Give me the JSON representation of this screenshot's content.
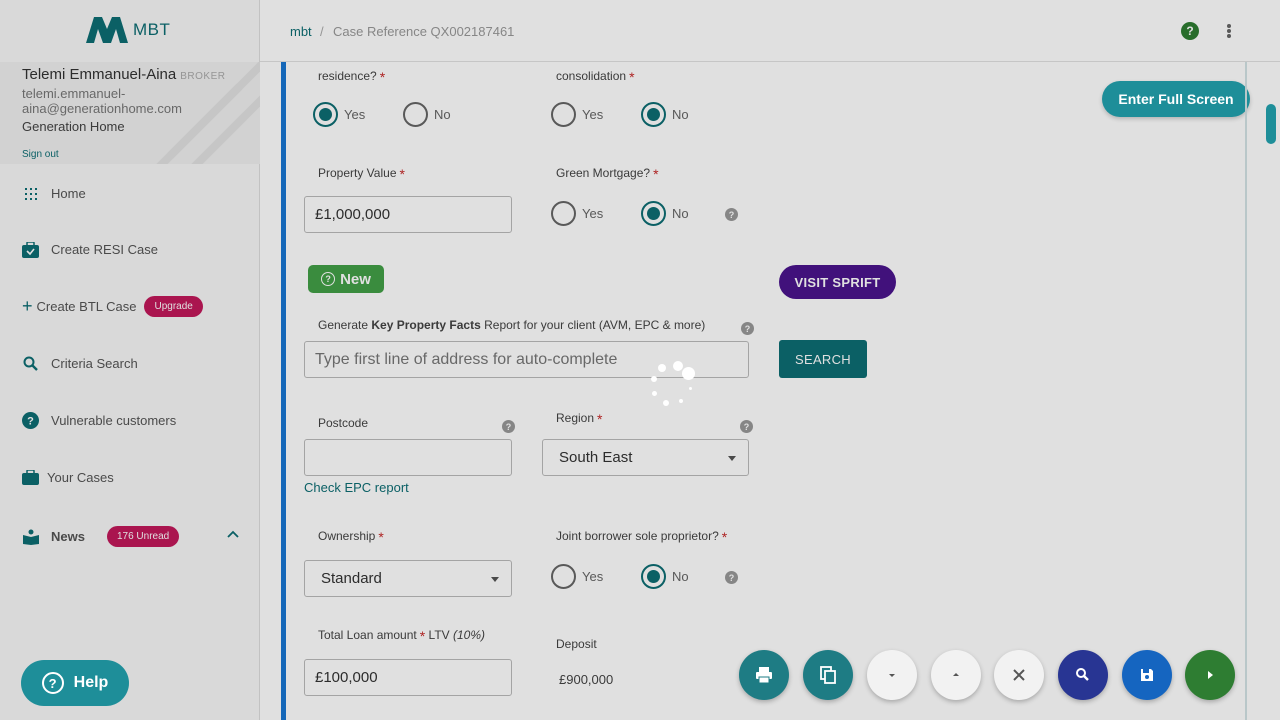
{
  "app": {
    "logo_text": "MBT"
  },
  "user": {
    "name": "Telemi Emmanuel-Aina",
    "role": "BROKER",
    "email": "telemi.emmanuel-aina@generationhome.com",
    "company": "Generation Home",
    "sign_out": "Sign out"
  },
  "nav": {
    "home": "Home",
    "create_resi": "Create RESI Case",
    "create_btl": "Create BTL Case",
    "upgrade_badge": "Upgrade",
    "criteria_search": "Criteria Search",
    "vulnerable": "Vulnerable customers",
    "your_cases": "Your Cases",
    "news": "News",
    "news_badge": "176 Unread"
  },
  "breadcrumb": {
    "home": "mbt",
    "separator": "/",
    "case": "Case Reference QX002187461"
  },
  "form": {
    "residence": {
      "label": "residence?",
      "yes": "Yes",
      "no": "No",
      "selected": "Yes"
    },
    "consolidation": {
      "label": "consolidation",
      "yes": "Yes",
      "no": "No",
      "selected": "No"
    },
    "property_value": {
      "label": "Property Value",
      "value": "£1,000,000"
    },
    "green_mortgage": {
      "label": "Green Mortgage?",
      "yes": "Yes",
      "no": "No",
      "selected": "No"
    },
    "new_badge": "New",
    "visit_button": "VISIT SPRIFT",
    "kpf": {
      "label_pre": "Generate ",
      "label_bold": "Key Property Facts",
      "label_post": " Report for your client (AVM, EPC & more)",
      "placeholder": "Type first line of address for auto-complete",
      "search_button": "SEARCH"
    },
    "postcode": {
      "label": "Postcode",
      "value": ""
    },
    "check_epc": "Check EPC report",
    "region": {
      "label": "Region",
      "value": "South East"
    },
    "ownership": {
      "label": "Ownership",
      "value": "Standard"
    },
    "joint_borrower": {
      "label": "Joint borrower sole proprietor?",
      "yes": "Yes",
      "no": "No",
      "selected": "No"
    },
    "total_loan": {
      "label": "Total Loan amount",
      "ltv_label": "LTV",
      "ltv_value": "(10%)",
      "value": "£100,000"
    },
    "deposit": {
      "label": "Deposit",
      "value": "£900,000"
    }
  },
  "controls": {
    "fullscreen": "Enter Full Screen",
    "help": "Help"
  },
  "colors": {
    "brand_teal": "#0d6e74",
    "accent_teal": "#1e8e99",
    "badge_pink": "#c2185b",
    "new_green": "#43a047",
    "visit_purple": "#4a148c",
    "fab_navy": "#283593",
    "fab_blue": "#1565c0",
    "fab_green": "#2e7d32"
  },
  "icons": {
    "fabs": [
      "print-icon",
      "copy-icon",
      "chevron-down-icon",
      "chevron-up-icon",
      "close-icon",
      "search-icon",
      "save-icon",
      "play-icon"
    ]
  }
}
